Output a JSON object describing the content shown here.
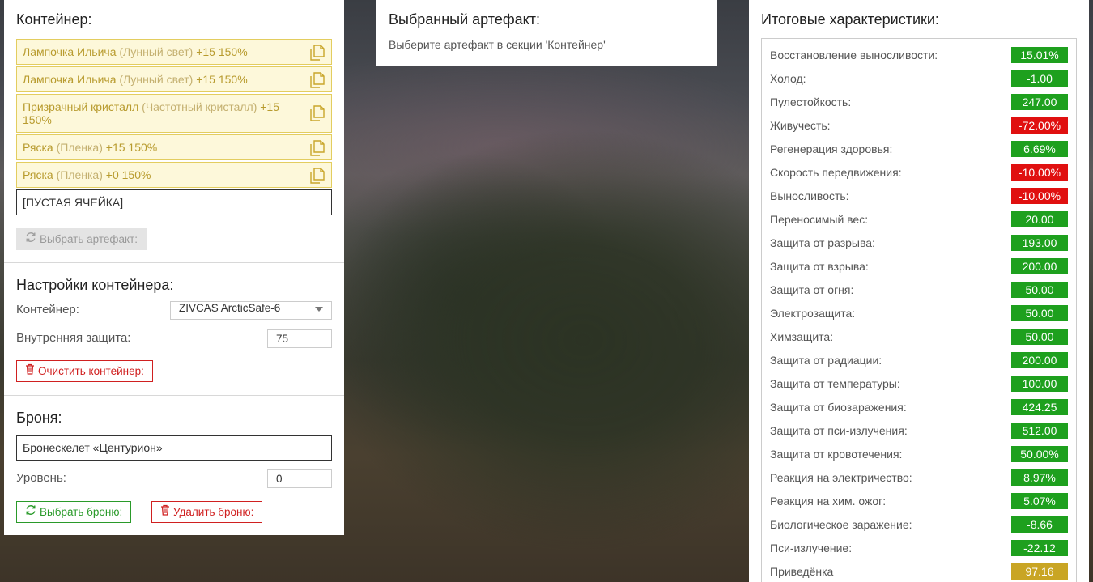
{
  "container_section": {
    "title": "Контейнер:",
    "slots": [
      {
        "name": "Лампочка Ильича",
        "type": "(Лунный свет)",
        "stats": "+15 150%"
      },
      {
        "name": "Лампочка Ильича",
        "type": "(Лунный свет)",
        "stats": "+15 150%"
      },
      {
        "name": "Призрачный кристалл",
        "type": "(Частотный кристалл)",
        "stats": "+15 150%"
      },
      {
        "name": "Ряска",
        "type": "(Пленка)",
        "stats": "+15 150%"
      },
      {
        "name": "Ряска",
        "type": "(Пленка)",
        "stats": "+0 150%"
      }
    ],
    "empty_slot": "[ПУСТАЯ ЯЧЕЙКА]",
    "select_artifact_button": "Выбрать артефакт:"
  },
  "container_settings": {
    "title": "Настройки контейнера:",
    "container_label": "Контейнер:",
    "container_value": "ZIVCAS ArcticSafe-6",
    "inner_protection_label": "Внутренняя защита:",
    "inner_protection_value": "75",
    "clear_button": "Очистить контейнер:"
  },
  "armor_section": {
    "title": "Броня:",
    "armor_name": "Бронескелет «Центурион»",
    "level_label": "Уровень:",
    "level_value": "0",
    "select_armor_button": "Выбрать броню:",
    "delete_armor_button": "Удалить броню:"
  },
  "selected_artifact": {
    "title": "Выбранный артефакт:",
    "hint": "Выберите артефакт в секции 'Контейнер'"
  },
  "totals": {
    "title": "Итоговые характеристики:",
    "stats": [
      {
        "label": "Восстановление выносливости:",
        "value": "15.01%",
        "color": "green"
      },
      {
        "label": "Холод:",
        "value": "-1.00",
        "color": "green"
      },
      {
        "label": "Пулестойкость:",
        "value": "247.00",
        "color": "green"
      },
      {
        "label": "Живучесть:",
        "value": "-72.00%",
        "color": "red"
      },
      {
        "label": "Регенерация здоровья:",
        "value": "6.69%",
        "color": "green"
      },
      {
        "label": "Скорость передвижения:",
        "value": "-10.00%",
        "color": "red"
      },
      {
        "label": "Выносливость:",
        "value": "-10.00%",
        "color": "red"
      },
      {
        "label": "Переносимый вес:",
        "value": "20.00",
        "color": "green"
      },
      {
        "label": "Защита от разрыва:",
        "value": "193.00",
        "color": "green"
      },
      {
        "label": "Защита от взрыва:",
        "value": "200.00",
        "color": "green"
      },
      {
        "label": "Защита от огня:",
        "value": "50.00",
        "color": "green"
      },
      {
        "label": "Электрозащита:",
        "value": "50.00",
        "color": "green"
      },
      {
        "label": "Химзащита:",
        "value": "50.00",
        "color": "green"
      },
      {
        "label": "Защита от радиации:",
        "value": "200.00",
        "color": "green"
      },
      {
        "label": "Защита от температуры:",
        "value": "100.00",
        "color": "green"
      },
      {
        "label": "Защита от биозаражения:",
        "value": "424.25",
        "color": "green"
      },
      {
        "label": "Защита от пси-излучения:",
        "value": "512.00",
        "color": "green"
      },
      {
        "label": "Защита от кровотечения:",
        "value": "50.00%",
        "color": "green"
      },
      {
        "label": "Реакция на электричество:",
        "value": "8.97%",
        "color": "green"
      },
      {
        "label": "Реакция на хим. ожог:",
        "value": "5.07%",
        "color": "green"
      },
      {
        "label": "Биологическое заражение:",
        "value": "-8.66",
        "color": "green"
      },
      {
        "label": "Пси-излучение:",
        "value": "-22.12",
        "color": "green"
      },
      {
        "label": "Приведёнка",
        "value": "97.16",
        "color": "yellow"
      }
    ]
  },
  "colors": {
    "green": "#1ea01e",
    "red": "#e01010",
    "yellow": "#c9a524",
    "slot_bg": "#fdf8da",
    "slot_border": "#e3cd5f"
  },
  "icons": {
    "copy": "copy-icon",
    "refresh": "refresh-icon",
    "trash": "trash-icon",
    "caret": "chevron-down-icon"
  }
}
